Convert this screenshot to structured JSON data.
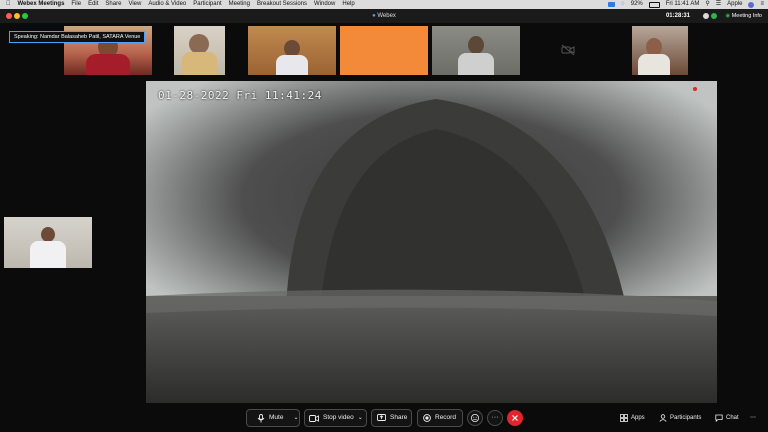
{
  "menubar": {
    "app_name": "Webex Meetings",
    "items": [
      "File",
      "Edit",
      "Share",
      "View",
      "Audio & Video",
      "Participant",
      "Meeting",
      "Breakout Sessions",
      "Window",
      "Help"
    ],
    "battery": "92%",
    "clock": "Fri 11:41 AM",
    "user": "Apple"
  },
  "window": {
    "title": "Webex",
    "timer": "01:28:31",
    "meeting_info": "Meeting Info"
  },
  "speaking_label": "Speaking:  Namdar Balasaheb Patil,  SATARA Venue",
  "stage": {
    "camera_timestamp": "01-28-2022 Fri 11:41:24"
  },
  "controls": {
    "mute": "Mute",
    "stop_video": "Stop video",
    "share": "Share",
    "record": "Record",
    "more": "···",
    "apps": "Apps",
    "participants": "Participants",
    "chat": "Chat"
  },
  "colors": {
    "accent_blue": "#4aa3ff",
    "end_red": "#e0262b",
    "orange_tile": "#f28a3a"
  }
}
